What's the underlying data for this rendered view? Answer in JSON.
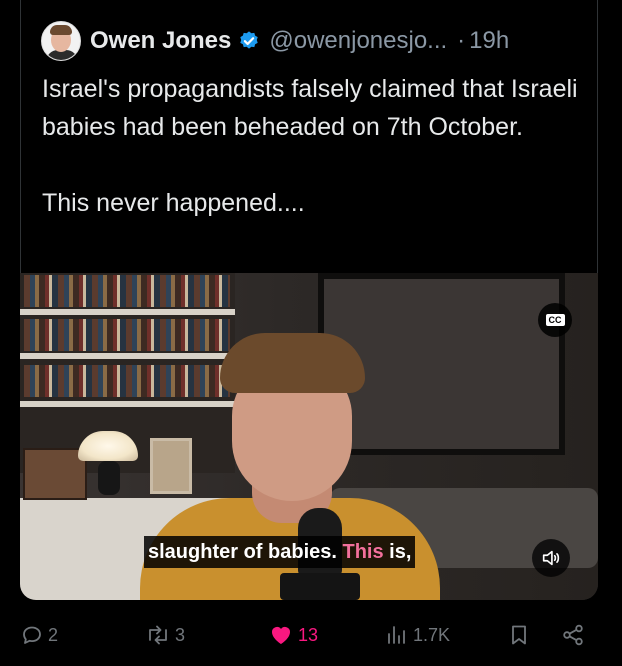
{
  "author": {
    "name": "Owen Jones",
    "handle": "@owenjonesjo...",
    "separator": "·",
    "time": "19h",
    "verified": true
  },
  "tweet": {
    "paragraph1": "Israel's propagandists falsely claimed that Israeli babies had been beheaded on 7th October.",
    "paragraph2": "This never happened...."
  },
  "video": {
    "cc_label": "CC",
    "caption_before": "slaughter of babies. ",
    "caption_highlight": "This",
    "caption_after": " is,"
  },
  "actions": {
    "replies": "2",
    "reposts": "3",
    "likes": "13",
    "views": "1.7K"
  },
  "colors": {
    "background": "#000000",
    "text": "#e7e9ea",
    "muted": "#71767b",
    "like": "#f91880",
    "verified": "#1d9bf0",
    "caption_highlight": "#f2709c"
  },
  "icons": [
    "verified-badge-icon",
    "closed-captions-icon",
    "volume-icon",
    "reply-icon",
    "repost-icon",
    "like-heart-icon",
    "views-chart-icon",
    "bookmark-icon",
    "share-icon"
  ]
}
